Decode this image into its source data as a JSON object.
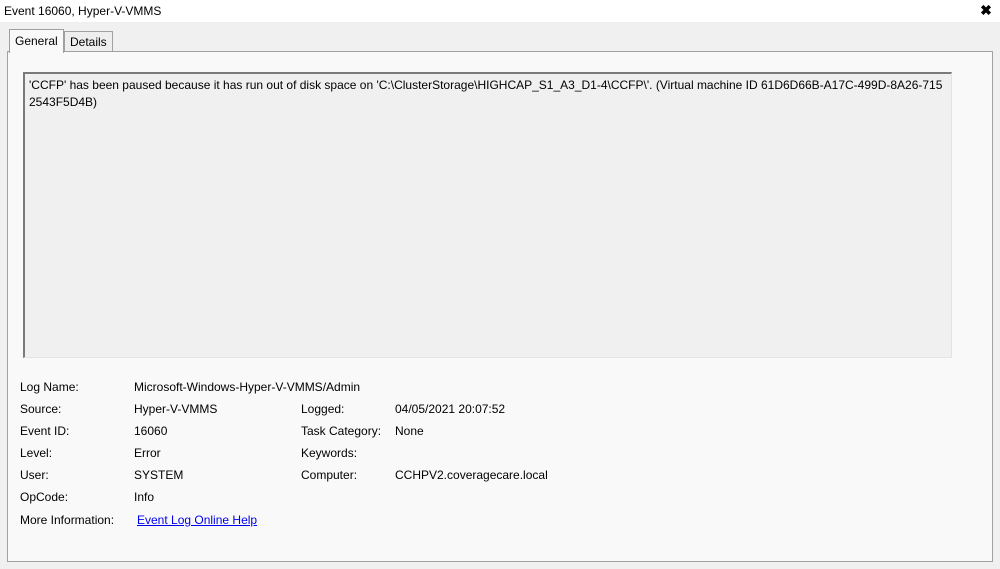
{
  "window": {
    "title": "Event 16060, Hyper-V-VMMS",
    "close_glyph": "✖"
  },
  "tabs": [
    {
      "label": "General"
    },
    {
      "label": "Details"
    }
  ],
  "description": "'CCFP' has been paused because it has run out of disk space on 'C:\\ClusterStorage\\HIGHCAP_S1_A3_D1-4\\CCFP\\'. (Virtual machine ID 61D6D66B-A17C-499D-8A26-7152543F5D4B)",
  "fields": {
    "log_name": {
      "label": "Log Name:",
      "value": "Microsoft-Windows-Hyper-V-VMMS/Admin"
    },
    "source": {
      "label": "Source:",
      "value": "Hyper-V-VMMS"
    },
    "logged": {
      "label": "Logged:",
      "value": "04/05/2021 20:07:52"
    },
    "event_id": {
      "label": "Event ID:",
      "value": "16060"
    },
    "task_category": {
      "label": "Task Category:",
      "value": "None"
    },
    "level": {
      "label": "Level:",
      "value": "Error"
    },
    "keywords": {
      "label": "Keywords:",
      "value": ""
    },
    "user": {
      "label": "User:",
      "value": "SYSTEM"
    },
    "computer": {
      "label": "Computer:",
      "value": "CCHPV2.coveragecare.local"
    },
    "opcode": {
      "label": "OpCode:",
      "value": "Info"
    },
    "more_info": {
      "label": "More Information:",
      "link": "Event Log Online Help"
    }
  }
}
